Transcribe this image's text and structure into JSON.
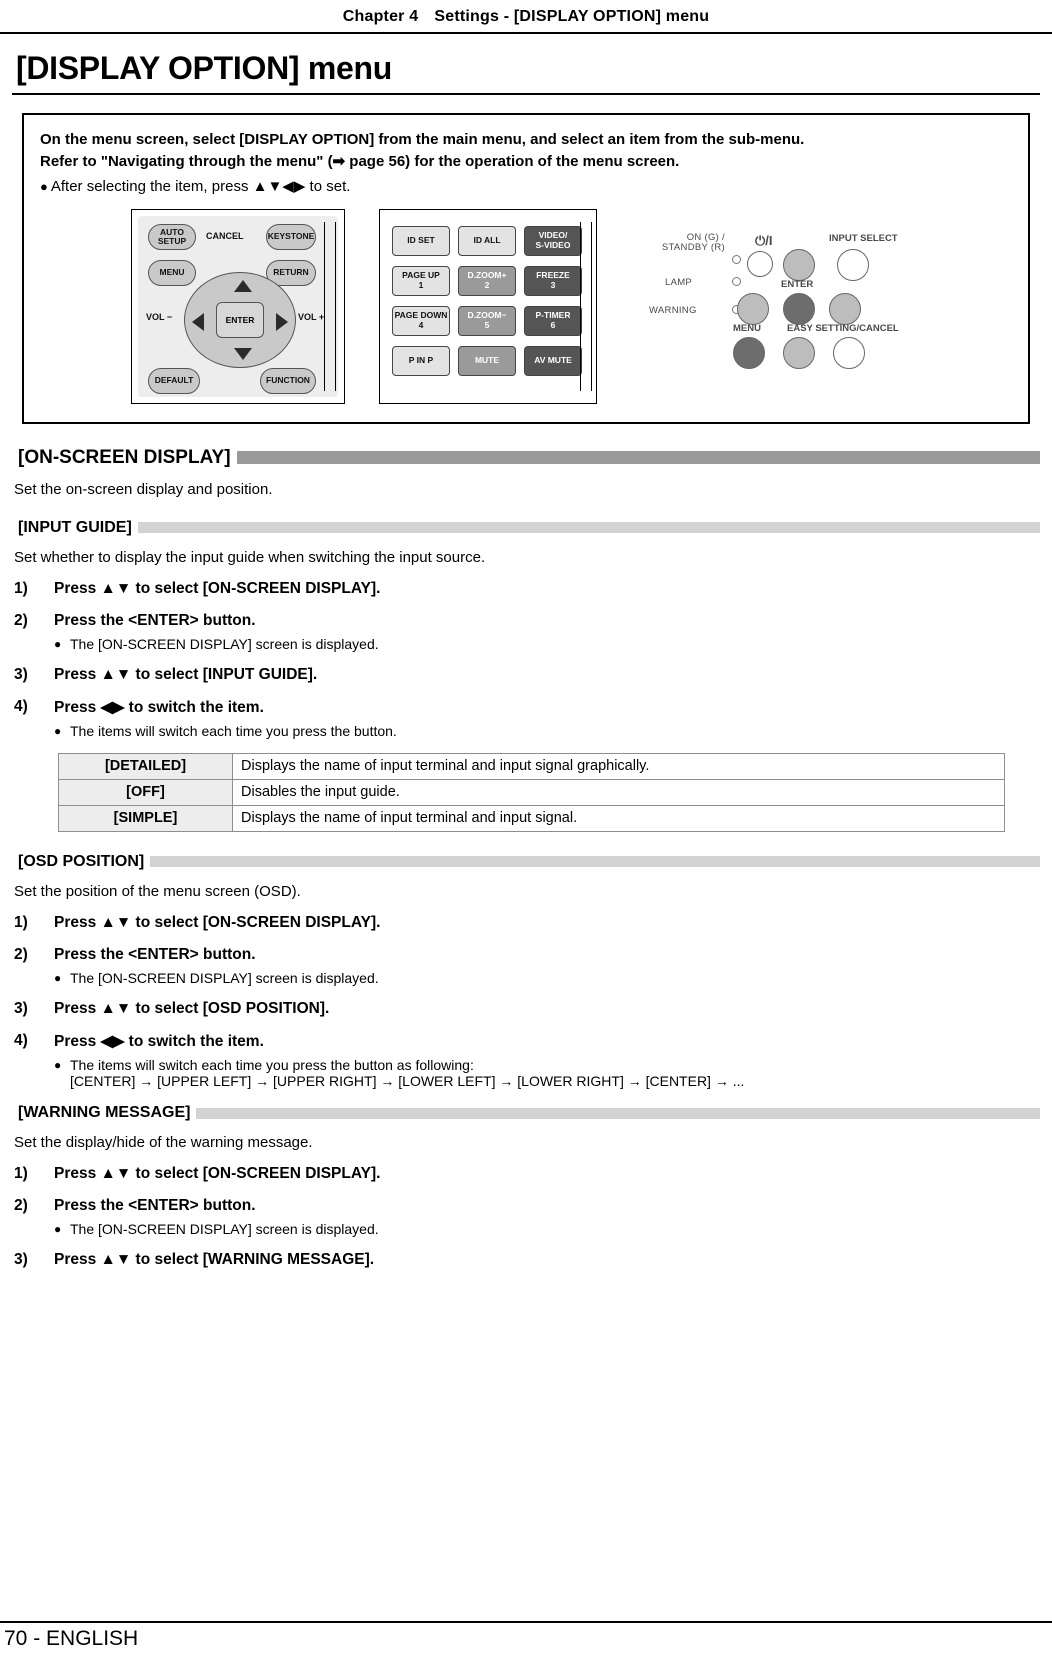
{
  "header": {
    "chapter": "Chapter 4",
    "subject": "Settings - [DISPLAY OPTION] menu"
  },
  "page_title": "[DISPLAY OPTION] menu",
  "intro": {
    "line1": "On the menu screen, select [DISPLAY OPTION] from the main menu, and select an item from the sub-menu.",
    "line2": "Refer to \"Navigating through the menu\" (➡ page 56) for the operation of the menu screen.",
    "bullet": "After selecting the item, press ▲▼◀▶ to set."
  },
  "remote1": {
    "auto_setup": "AUTO SETUP",
    "cancel": "CANCEL",
    "keystone": "KEYSTONE",
    "menu": "MENU",
    "return": "RETURN",
    "vol_minus": "VOL −",
    "vol_plus": "VOL +",
    "enter": "ENTER",
    "default": "DEFAULT",
    "function": "FUNCTION"
  },
  "remote2": {
    "keys": [
      {
        "l1": "ID SET",
        "l2": "",
        "style": "light"
      },
      {
        "l1": "ID ALL",
        "l2": "",
        "style": "light"
      },
      {
        "l1": "VIDEO/",
        "l2": "S-VIDEO",
        "style": "dark"
      },
      {
        "l1": "PAGE UP",
        "l2": "1",
        "style": "light"
      },
      {
        "l1": "D.ZOOM+",
        "l2": "2",
        "style": "mid"
      },
      {
        "l1": "FREEZE",
        "l2": "3",
        "style": "dark"
      },
      {
        "l1": "PAGE DOWN",
        "l2": "4",
        "style": "light"
      },
      {
        "l1": "D.ZOOM−",
        "l2": "5",
        "style": "mid"
      },
      {
        "l1": "P-TIMER",
        "l2": "6",
        "style": "dark"
      },
      {
        "l1": "P IN P",
        "l2": "",
        "style": "light"
      },
      {
        "l1": "MUTE",
        "l2": "",
        "style": "mid"
      },
      {
        "l1": "AV MUTE",
        "l2": "",
        "style": "dark"
      }
    ]
  },
  "remote3": {
    "on_standby": "ON (G) / STANDBY (R)",
    "lamp": "LAMP",
    "warning": "WARNING",
    "power": "⏻/I",
    "input_select": "INPUT  SELECT",
    "enter": "ENTER",
    "menu": "MENU",
    "easy_setting": "EASY SETTING/CANCEL"
  },
  "sections": {
    "on_screen_display": {
      "title": "[ON-SCREEN DISPLAY]",
      "desc": "Set the on-screen display and position."
    },
    "input_guide": {
      "title": "[INPUT GUIDE]",
      "desc": "Set whether to display the input guide when switching the input source.",
      "steps": [
        {
          "num": "1)",
          "text": "Press ▲▼ to select [ON-SCREEN DISPLAY].",
          "sub": null
        },
        {
          "num": "2)",
          "text": "Press the <ENTER> button.",
          "sub": "The [ON-SCREEN DISPLAY] screen is displayed."
        },
        {
          "num": "3)",
          "text": "Press ▲▼ to select [INPUT GUIDE].",
          "sub": null
        },
        {
          "num": "4)",
          "text": "Press ◀▶ to switch the item.",
          "sub": "The items will switch each time you press the button."
        }
      ],
      "table": [
        {
          "key": "[DETAILED]",
          "value": "Displays the name of input terminal and input signal graphically."
        },
        {
          "key": "[OFF]",
          "value": "Disables the input guide."
        },
        {
          "key": "[SIMPLE]",
          "value": "Displays the name of input terminal and input signal."
        }
      ]
    },
    "osd_position": {
      "title": "[OSD POSITION]",
      "desc": "Set the position of the menu screen (OSD).",
      "steps": [
        {
          "num": "1)",
          "text": "Press ▲▼ to select [ON-SCREEN DISPLAY].",
          "sub": null
        },
        {
          "num": "2)",
          "text": "Press the <ENTER> button.",
          "sub": "The [ON-SCREEN DISPLAY] screen is displayed."
        },
        {
          "num": "3)",
          "text": "Press ▲▼ to select [OSD POSITION].",
          "sub": null
        },
        {
          "num": "4)",
          "text": "Press ◀▶ to switch the item.",
          "sub": "The items will switch each time you press the button as following:"
        }
      ],
      "cycle": "[CENTER] → [UPPER LEFT] → [UPPER RIGHT] → [LOWER LEFT] → [LOWER RIGHT] → [CENTER] → ..."
    },
    "warning_message": {
      "title": "[WARNING MESSAGE]",
      "desc": "Set the display/hide of the warning message.",
      "steps": [
        {
          "num": "1)",
          "text": "Press ▲▼ to select [ON-SCREEN DISPLAY].",
          "sub": null
        },
        {
          "num": "2)",
          "text": "Press the <ENTER> button.",
          "sub": "The [ON-SCREEN DISPLAY] screen is displayed."
        },
        {
          "num": "3)",
          "text": "Press ▲▼ to select [WARNING MESSAGE].",
          "sub": null
        }
      ]
    }
  },
  "footer": "70 - ENGLISH"
}
